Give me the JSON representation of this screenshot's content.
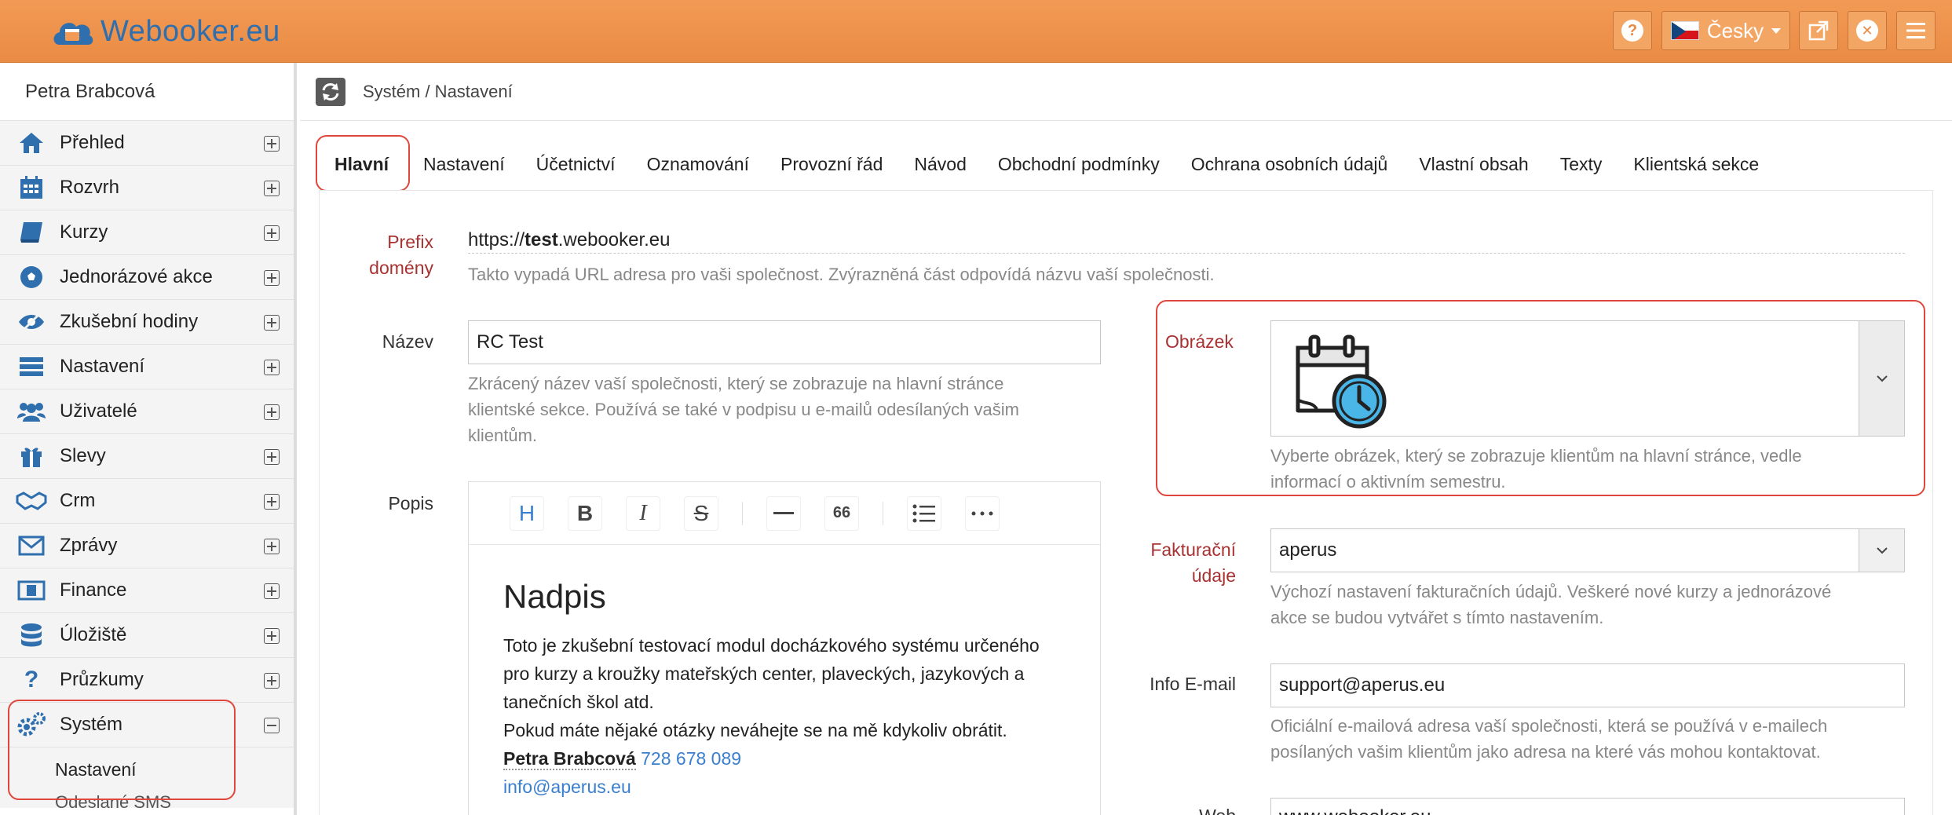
{
  "app": {
    "brand": "Webooker.eu"
  },
  "topbar": {
    "help_icon": "question-circle-icon",
    "language": "Česky",
    "external_icon": "external-link-icon",
    "close_icon": "close-circle-icon",
    "menu_icon": "hamburger-icon"
  },
  "sidebar": {
    "user": "Petra Brabcová",
    "items": [
      {
        "label": "Přehled",
        "icon": "home-icon"
      },
      {
        "label": "Rozvrh",
        "icon": "calendar-icon"
      },
      {
        "label": "Kurzy",
        "icon": "book-icon"
      },
      {
        "label": "Jednorázové akce",
        "icon": "soccer-ball-icon"
      },
      {
        "label": "Zkušební hodiny",
        "icon": "eye-slash-icon"
      },
      {
        "label": "Nastavení",
        "icon": "list-icon"
      },
      {
        "label": "Uživatelé",
        "icon": "users-icon"
      },
      {
        "label": "Slevy",
        "icon": "gift-icon"
      },
      {
        "label": "Crm",
        "icon": "handshake-icon"
      },
      {
        "label": "Zprávy",
        "icon": "envelope-icon"
      },
      {
        "label": "Finance",
        "icon": "money-icon"
      },
      {
        "label": "Úložiště",
        "icon": "database-icon"
      },
      {
        "label": "Průzkumy",
        "icon": "question-icon"
      },
      {
        "label": "Systém",
        "icon": "gears-icon"
      }
    ],
    "sub_active": "Nastavení",
    "sub_next": "Odeslané SMS"
  },
  "breadcrumb": "Systém / Nastavení",
  "tabs": [
    "Hlavní",
    "Nastavení",
    "Účetnictví",
    "Oznamování",
    "Provozní řád",
    "Návod",
    "Obchodní podmínky",
    "Ochrana osobních údajů",
    "Vlastní obsah",
    "Texty",
    "Klientská sekce"
  ],
  "form": {
    "prefix_label_1": "Prefix",
    "prefix_label_2": "domény",
    "prefix_url_pre": "https://",
    "prefix_url_bold": "test",
    "prefix_url_post": ".webooker.eu",
    "prefix_help": "Takto vypadá URL adresa pro vaši společnost. Zvýrazněná část odpovídá názvu vaší společnosti.",
    "name_label": "Název",
    "name_value": "RC Test",
    "name_help_1": "Zkrácený název vaší společnosti, který se zobrazuje na hlavní stránce",
    "name_help_2": "klientské sekce. Používá se také v podpisu u e-mailů odesílaných vašim",
    "name_help_3": "klientům.",
    "desc_label": "Popis",
    "image_label": "Obrázek",
    "image_icon": "calendar-clock-icon",
    "image_help_1": "Vyberte obrázek, který se zobrazuje klientům na hlavní stránce, vedle",
    "image_help_2": "informací o aktivním semestru.",
    "billing_label_1": "Fakturační",
    "billing_label_2": "údaje",
    "billing_value": "aperus",
    "billing_help_1": "Výchozí nastavení fakturačních údajů. Veškeré nové kurzy a jednorázové",
    "billing_help_2": "akce se budou vytvářet s tímto nastavením.",
    "email_label": "Info E-mail",
    "email_value": "support@aperus.eu",
    "email_help_1": "Oficiální e-mailová adresa vaší společnosti, která se používá v e-mailech",
    "email_help_2": "posílaných vašim klientům jako adresa na které vás mohou kontaktovat.",
    "web_label": "Web",
    "web_value": "www.webooker.eu"
  },
  "editor": {
    "toolbar": {
      "heading": "H",
      "bold": "B",
      "italic": "I",
      "strike": "S",
      "quote": "66"
    },
    "heading": "Nadpis",
    "line1": "Toto je zkušební testovací modul docházkového systému určeného",
    "line2": "pro kurzy a kroužky mateřských center, plaveckých, jazykových a",
    "line3": "tanečních škol atd.",
    "line4": "Pokud máte nějaké otázky neváhejte se na mě kdykoliv obrátit.",
    "sig_name": "Petra Brabcová",
    "sig_phone": "728 678 089",
    "sig_email": "info@aperus.eu"
  }
}
